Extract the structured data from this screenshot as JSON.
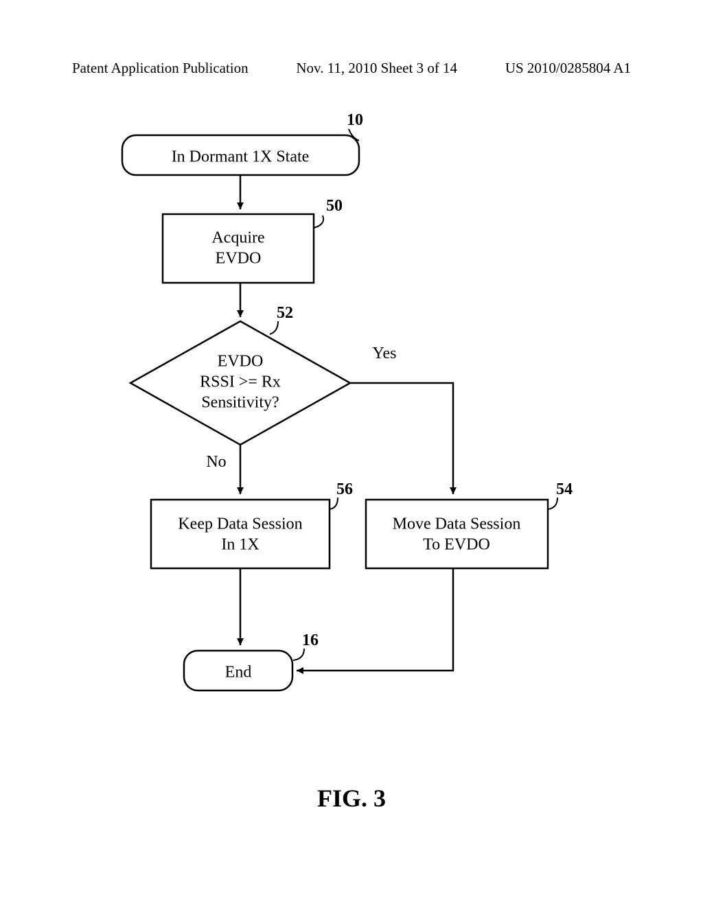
{
  "header": {
    "left": "Patent Application Publication",
    "center": "Nov. 11, 2010  Sheet 3 of 14",
    "right": "US 2010/0285804 A1"
  },
  "refs": {
    "start": "10",
    "acquire": "50",
    "decision": "52",
    "move": "54",
    "keep": "56",
    "end": "16"
  },
  "nodes": {
    "start": "In Dormant 1X State",
    "acquire_l1": "Acquire",
    "acquire_l2": "EVDO",
    "decision_l1": "EVDO",
    "decision_l2": "RSSI  >=  Rx",
    "decision_l3": "Sensitivity?",
    "keep_l1": "Keep Data Session",
    "keep_l2": "In 1X",
    "move_l1": "Move Data Session",
    "move_l2": "To EVDO",
    "end": "End"
  },
  "labels": {
    "yes": "Yes",
    "no": "No"
  },
  "figure": "FIG. 3"
}
